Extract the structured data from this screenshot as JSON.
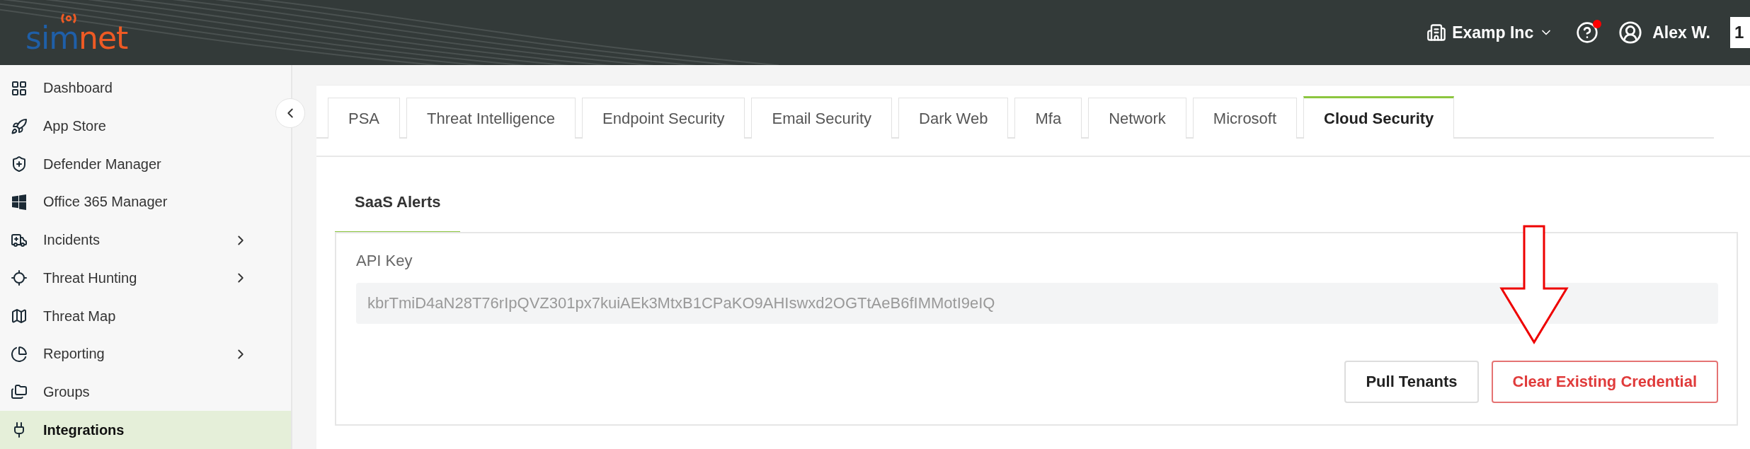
{
  "header": {
    "logo": [
      "sim",
      "net"
    ],
    "company": "Examp Inc",
    "user": "Alex W.",
    "help_notification": true,
    "corner_badge": "1"
  },
  "sidebar": {
    "items": [
      {
        "label": "Dashboard",
        "selected": false,
        "has_children": false
      },
      {
        "label": "App Store",
        "selected": false,
        "has_children": false
      },
      {
        "label": "Defender Manager",
        "selected": false,
        "has_children": false
      },
      {
        "label": "Office 365 Manager",
        "selected": false,
        "has_children": false
      },
      {
        "label": "Incidents",
        "selected": false,
        "has_children": true
      },
      {
        "label": "Threat Hunting",
        "selected": false,
        "has_children": true
      },
      {
        "label": "Threat Map",
        "selected": false,
        "has_children": false
      },
      {
        "label": "Reporting",
        "selected": false,
        "has_children": true
      },
      {
        "label": "Groups",
        "selected": false,
        "has_children": false
      },
      {
        "label": "Integrations",
        "selected": true,
        "has_children": false
      }
    ]
  },
  "tabs": [
    {
      "label": "PSA",
      "selected": false
    },
    {
      "label": "Threat Intelligence",
      "selected": false
    },
    {
      "label": "Endpoint Security",
      "selected": false
    },
    {
      "label": "Email Security",
      "selected": false
    },
    {
      "label": "Dark Web",
      "selected": false
    },
    {
      "label": "Mfa",
      "selected": false
    },
    {
      "label": "Network",
      "selected": false
    },
    {
      "label": "Microsoft",
      "selected": false
    },
    {
      "label": "Cloud Security",
      "selected": true
    }
  ],
  "sub_tabs": [
    {
      "label": "SaaS Alerts",
      "selected": true
    }
  ],
  "form": {
    "api_key_label": "API Key",
    "api_key_value": "kbrTmiD4aN28T76rIpQVZ301px7kuiAEk3MtxB1CPaKO9AHIswxd2OGTtAeB6fIMMotI9eIQ",
    "buttons": [
      {
        "label": "Pull Tenants",
        "kind": "default"
      },
      {
        "label": "Clear Existing Credential",
        "kind": "danger"
      }
    ]
  }
}
